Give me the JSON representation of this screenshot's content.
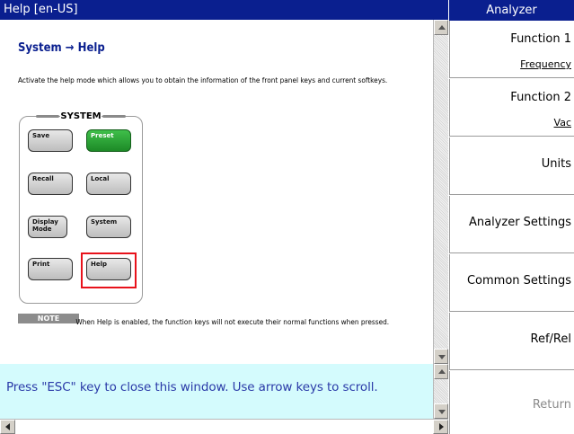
{
  "help_window": {
    "title": "Help [en-US]",
    "heading": "System → Help",
    "description": "Activate the help mode which allows you to obtain the information of the front panel keys and current softkeys.",
    "system_panel": {
      "legend": "SYSTEM",
      "keys": [
        "Save",
        "Preset",
        "Recall",
        "Local",
        "Display Mode",
        "System",
        "Print",
        "Help"
      ],
      "highlighted_key": "Help"
    },
    "note": {
      "label": "NOTE",
      "text": "When Help is enabled, the function keys will not execute their normal functions when pressed."
    },
    "hint": "Press \"ESC\" key to close this window. Use arrow keys to scroll."
  },
  "softkeys": {
    "title": "Analyzer",
    "items": [
      {
        "label": "Function 1",
        "value": "Frequency"
      },
      {
        "label": "Function 2",
        "value": "Vac"
      },
      {
        "label": "Units"
      },
      {
        "label": "Analyzer Settings"
      },
      {
        "label": "Common Settings"
      },
      {
        "label": "Ref/Rel"
      },
      {
        "label": "Return",
        "disabled": true
      }
    ]
  },
  "colors": {
    "title_bar": "#0a1f8f",
    "hint_background": "#d4fbfd",
    "hint_text": "#2a3aa8",
    "preset_key": "#2fa83a",
    "highlight": "#e8121b"
  },
  "icons": [
    "scroll-up-arrow-icon",
    "scroll-down-arrow-icon",
    "scroll-left-arrow-icon",
    "scroll-right-arrow-icon"
  ]
}
